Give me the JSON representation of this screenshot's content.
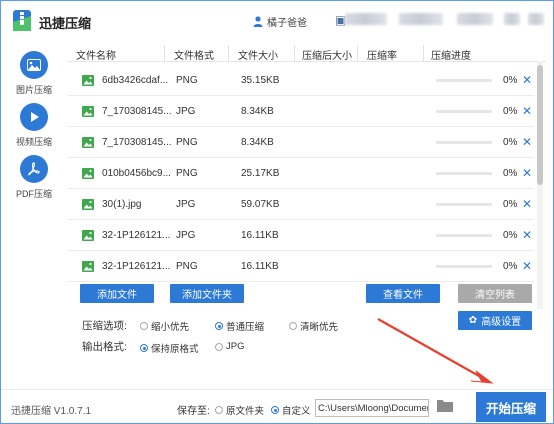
{
  "app": {
    "title": "迅捷压缩",
    "user_name": "橘子爸爸",
    "version": "迅捷压缩 V1.0.7.1"
  },
  "sidebar": {
    "items": [
      {
        "label": "图片压缩",
        "icon": "image-icon"
      },
      {
        "label": "视频压缩",
        "icon": "play-icon"
      },
      {
        "label": "PDF压缩",
        "icon": "pdf-icon"
      }
    ]
  },
  "table": {
    "headers": [
      "文件名称",
      "文件格式",
      "文件大小",
      "压缩后大小",
      "压缩率",
      "压缩进度"
    ],
    "rows": [
      {
        "name": "6db3426cdaf...",
        "format": "PNG",
        "size": "35.15KB",
        "progress": "0%",
        "progress_value": 0
      },
      {
        "name": "7_170308145...",
        "format": "JPG",
        "size": "8.34KB",
        "progress": "0%",
        "progress_value": 0
      },
      {
        "name": "7_170308145...",
        "format": "PNG",
        "size": "8.34KB",
        "progress": "0%",
        "progress_value": 0
      },
      {
        "name": "010b0456bc9...",
        "format": "PNG",
        "size": "25.17KB",
        "progress": "0%",
        "progress_value": 0
      },
      {
        "name": "30(1).jpg",
        "format": "JPG",
        "size": "59.07KB",
        "progress": "0%",
        "progress_value": 0
      },
      {
        "name": "32-1P126121...",
        "format": "JPG",
        "size": "16.11KB",
        "progress": "0%",
        "progress_value": 0
      },
      {
        "name": "32-1P126121...",
        "format": "PNG",
        "size": "16.11KB",
        "progress": "0%",
        "progress_value": 0
      }
    ],
    "remove_glyph": "✕"
  },
  "actions": {
    "add_file": "添加文件",
    "add_folder": "添加文件夹",
    "view_file": "查看文件",
    "clear_list": "清空列表",
    "advanced": "高级设置"
  },
  "compress_options": {
    "label": "压缩选项:",
    "options": [
      {
        "label": "缩小优先",
        "selected": false
      },
      {
        "label": "普通压缩",
        "selected": true
      },
      {
        "label": "清晰优先",
        "selected": false
      }
    ]
  },
  "output_format": {
    "label": "输出格式:",
    "options": [
      {
        "label": "保持原格式",
        "selected": true
      },
      {
        "label": "JPG",
        "selected": false
      }
    ]
  },
  "footer": {
    "save_to_label": "保存至:",
    "options": [
      {
        "label": "原文件夹",
        "selected": false
      },
      {
        "label": "自定义",
        "selected": true
      }
    ],
    "path": "C:\\Users\\Mloong\\Documents",
    "start_button": "开始压缩"
  },
  "colors": {
    "accent": "#2d7ad6",
    "gray_button": "#a9a9a9",
    "annotation_arrow": "#e8402f",
    "image_icon": "#3fa84d"
  }
}
